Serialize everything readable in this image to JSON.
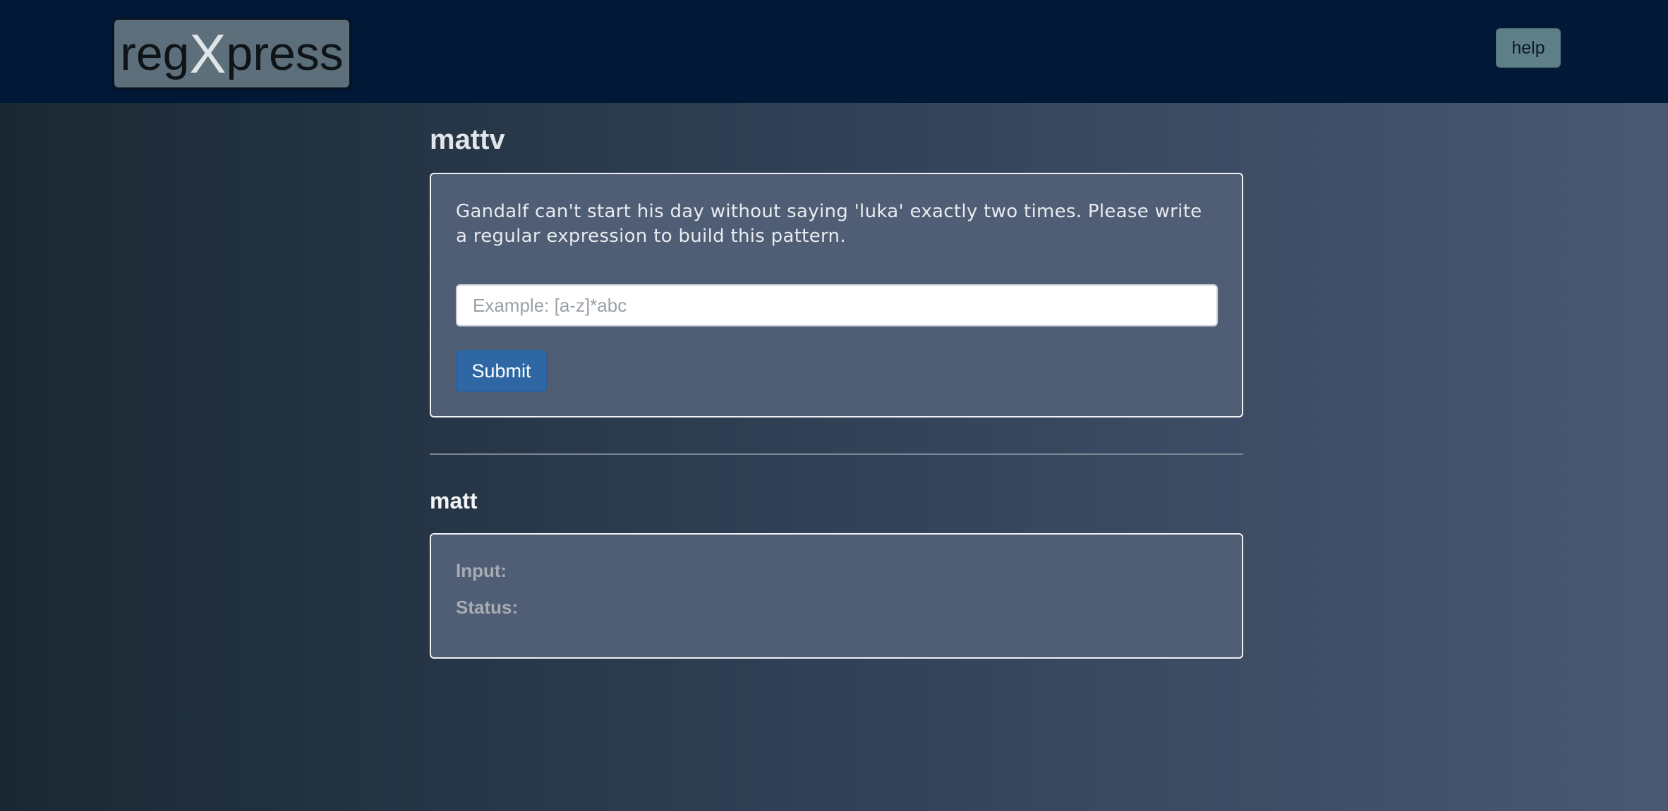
{
  "header": {
    "brand_prefix": "reg",
    "brand_x": "X",
    "brand_suffix": "press",
    "help_label": "help"
  },
  "challenge": {
    "username": "mattv",
    "prompt": "Gandalf can't start his day without saying 'luka' exactly two times. Please write a regular expression to build this pattern.",
    "input_value": "",
    "input_placeholder": "Example: [a-z]*abc",
    "submit_label": "Submit"
  },
  "result": {
    "username": "matt",
    "input_label": "Input:",
    "status_label": "Status:"
  },
  "colors": {
    "navbar": "#021837",
    "brand_bg": "#5c6f7a",
    "help_bg": "#5f7f88",
    "panel_bg": "#4f5d75",
    "submit_bg": "#2f67a4"
  }
}
